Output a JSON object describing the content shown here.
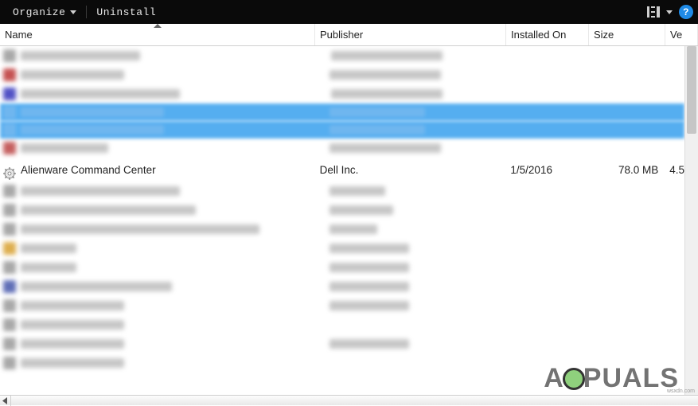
{
  "toolbar": {
    "organize_label": "Organize",
    "uninstall_label": "Uninstall",
    "help_glyph": "?"
  },
  "columns": {
    "name": "Name",
    "publisher": "Publisher",
    "installed": "Installed On",
    "size": "Size",
    "version": "Ve"
  },
  "visible_row": {
    "name": "Alienware Command Center",
    "publisher": "Dell Inc.",
    "installed": "1/5/2016",
    "size": "78.0 MB",
    "version": "4.5"
  },
  "branding": {
    "text_before": "A",
    "text_after": "PUALS",
    "watermark": "wsxdn.com"
  },
  "colors": {
    "toolbar_bg": "#0a0a0a",
    "selection": "#55aef0",
    "help_icon": "#1f8ae6"
  }
}
